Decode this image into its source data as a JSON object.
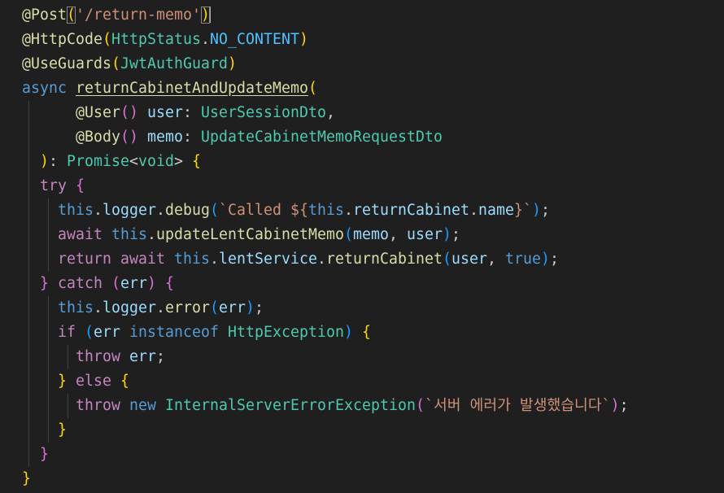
{
  "editor": {
    "decorator_post": "@Post",
    "route": "'/return-memo'",
    "decorator_httpcode": "@HttpCode",
    "http_status_class": "HttpStatus",
    "http_status_const": "NO_CONTENT",
    "decorator_guards": "@UseGuards",
    "guard_class": "JwtAuthGuard",
    "kw_async": "async",
    "method_name": "returnCabinetAndUpdateMemo",
    "decorator_user": "@User",
    "param_user": "user",
    "type_user": "UserSessionDto",
    "decorator_body": "@Body",
    "param_memo": "memo",
    "type_memo": "UpdateCabinetMemoRequestDto",
    "promise_type": "Promise",
    "void_type": "void",
    "kw_try": "try",
    "kw_this": "this",
    "prop_logger": "logger",
    "method_debug": "debug",
    "tpl_called_prefix": "`Called ${",
    "prop_return_cabinet": "returnCabinet",
    "prop_name": "name",
    "tpl_close": "}`",
    "kw_await": "await",
    "method_update_memo": "updateLentCabinetMemo",
    "kw_return": "return",
    "prop_lent_service": "lentService",
    "method_return_cabinet": "returnCabinet",
    "kw_true": "true",
    "kw_catch": "catch",
    "var_err": "err",
    "method_error": "error",
    "kw_if": "if",
    "kw_instanceof": "instanceof",
    "http_exception_class": "HttpException",
    "kw_throw": "throw",
    "kw_else": "else",
    "kw_new": "new",
    "ise_class": "InternalServerErrorException",
    "error_message": "`서버 에러가 발생했습니다`"
  }
}
